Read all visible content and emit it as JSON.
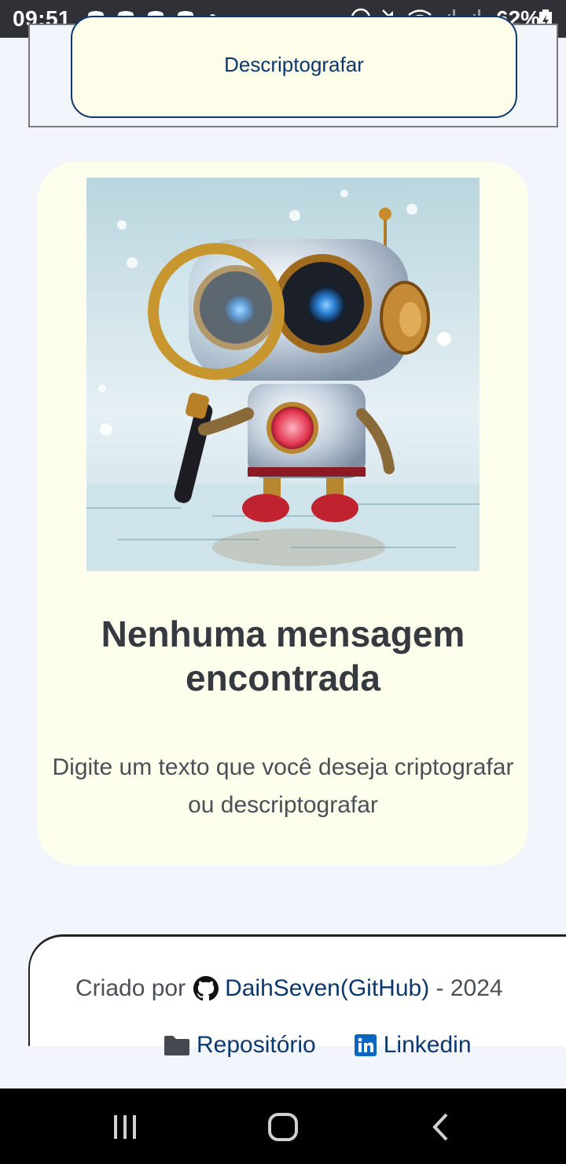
{
  "status_bar": {
    "time": "09:51",
    "battery": "62%"
  },
  "encrypt_panel": {
    "decrypt_label": "Descriptografar"
  },
  "result_card": {
    "title": "Nenhuma mensagem encontrada",
    "text": "Digite um texto que você deseja criptografar ou descriptografar"
  },
  "footer": {
    "created_by_prefix": "Criado por",
    "github_link": "DaihSeven(GitHub)",
    "year_suffix": " - 2024",
    "repo_label": "Repositório",
    "linkedin_label": "Linkedin"
  },
  "colors": {
    "primary": "#0a3871",
    "card_bg": "#fdfeeb",
    "page_bg": "#f3f5fc"
  },
  "icons": [
    "discord-icon",
    "dnd-icon",
    "mute-icon",
    "wifi-icon",
    "signal-icon",
    "battery-icon",
    "github-icon",
    "folder-icon",
    "linkedin-icon",
    "recents-icon",
    "home-icon",
    "back-icon"
  ]
}
